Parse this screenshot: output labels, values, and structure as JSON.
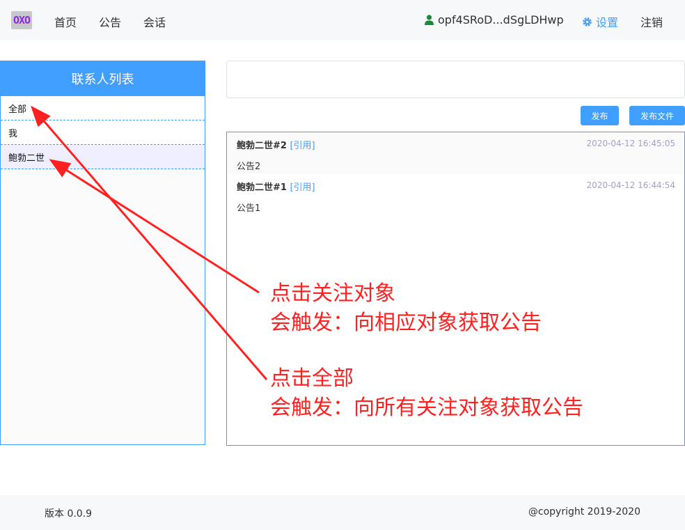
{
  "header": {
    "logo": "OXO",
    "nav": [
      "首页",
      "公告",
      "会话"
    ],
    "user": "opf4SRoD...dSgLDHwp",
    "settings": "设置",
    "logout": "注销"
  },
  "contacts": {
    "title": "联系人列表",
    "items": [
      "全部",
      "我",
      "鲍勃二世"
    ]
  },
  "post": {
    "input_value": "",
    "publish_label": "发布",
    "publish_file_label": "发布文件"
  },
  "notices": [
    {
      "author": "鲍勃二世#2",
      "quote": "[引用]",
      "time": "2020-04-12 16:45:05",
      "body": "公告2"
    },
    {
      "author": "鲍勃二世#1",
      "quote": "[引用]",
      "time": "2020-04-12 16:44:54",
      "body": "公告1"
    }
  ],
  "annotations": {
    "note1_line1": "点击关注对象",
    "note1_line2": "会触发：向相应对象获取公告",
    "note2_line1": "点击全部",
    "note2_line2": "会触发：向所有关注对象获取公告"
  },
  "footer": {
    "version": "版本 0.0.9",
    "copyright": "@copyright 2019-2020"
  },
  "colors": {
    "accent": "#409eff",
    "annotation": "#ff2020",
    "logo_text": "#8a2be2"
  }
}
